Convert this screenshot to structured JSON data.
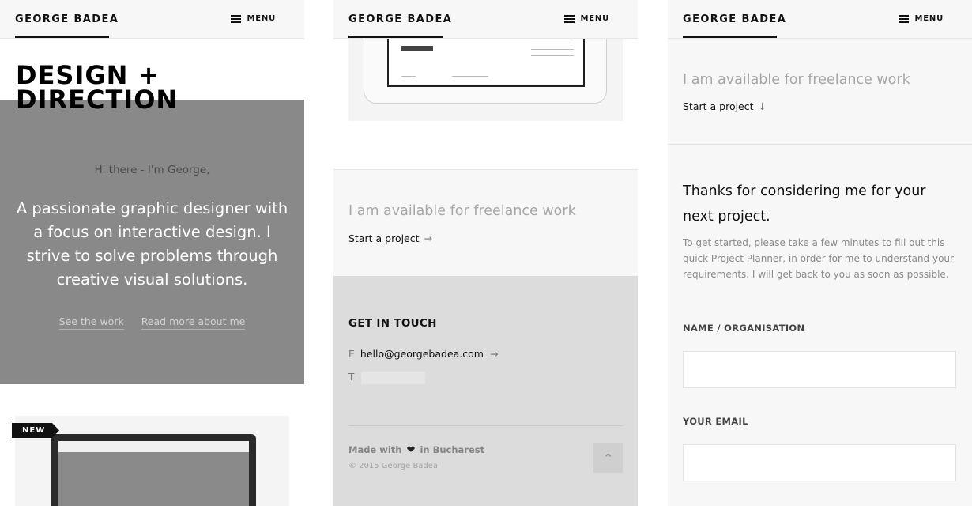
{
  "header": {
    "brand": "GEORGE BADEA",
    "menu_label": "MENU",
    "menu_icon": "hamburger-icon"
  },
  "home": {
    "title_line1": "DESIGN +",
    "title_line2": "DIRECTION",
    "greeting": "Hi there - I'm George,",
    "intro": "A passionate graphic designer with a focus on interactive design. I strive to solve problems through creative visual solutions.",
    "link_work": "See the work",
    "link_about": "Read more about me",
    "badge": "NEW"
  },
  "footer_view": {
    "available": "I am available for freelance work",
    "start_project": "Start a project",
    "start_arrow": "→",
    "get_in_touch": "GET IN TOUCH",
    "email_label": "E",
    "email": "hello@georgebadea.com",
    "email_arrow": "→",
    "phone_label": "T",
    "made_with_prefix": "Made with",
    "heart": "❤",
    "made_with_suffix": "in Bucharest",
    "copyright": "© 2015 George Badea",
    "back_to_top": "^"
  },
  "planner": {
    "available": "I am available for freelance work",
    "start_project": "Start a project",
    "start_arrow": "↓",
    "thanks": "Thanks for considering me for your next project.",
    "description": "To get started, please take a few minutes to fill out this quick Project Planner, in order for me to understand your requirements. I will get back to you as soon as possible.",
    "field_name_label": "NAME / ORGANISATION",
    "field_name_value": "",
    "field_email_label": "YOUR EMAIL",
    "field_email_value": ""
  },
  "colors": {
    "hero_gray": "#898989",
    "footer_gray": "#dcdcdc",
    "muted_text": "#a7a7a7"
  }
}
